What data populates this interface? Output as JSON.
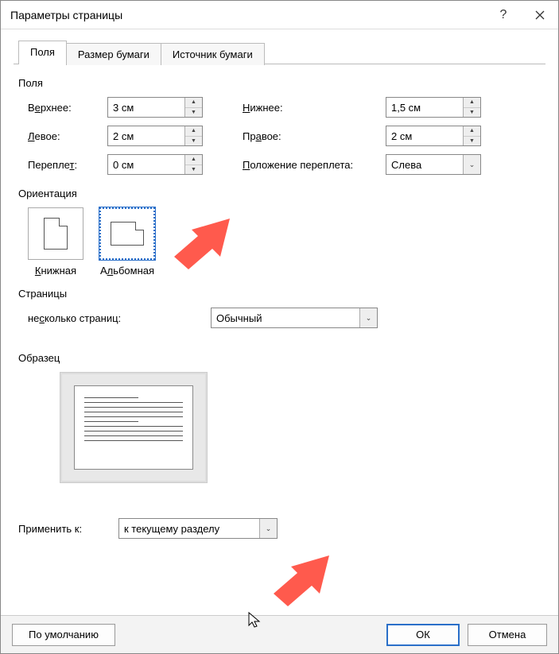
{
  "title": "Параметры страницы",
  "tabs": [
    "Поля",
    "Размер бумаги",
    "Источник бумаги"
  ],
  "margins": {
    "group_label": "Поля",
    "top_label_pre": "В",
    "top_label_u": "е",
    "top_label_post": "рхнее:",
    "bottom_label_pre": "",
    "bottom_label_u": "Н",
    "bottom_label_post": "ижнее:",
    "left_label_pre": "",
    "left_label_u": "Л",
    "left_label_post": "евое:",
    "right_label_pre": "Пр",
    "right_label_u": "а",
    "right_label_post": "вое:",
    "gutter_label_pre": "Перепле",
    "gutter_label_u": "т",
    "gutter_label_post": ":",
    "gutterpos_label_pre": "",
    "gutterpos_label_u": "П",
    "gutterpos_label_post": "оложение переплета:",
    "top": "3 см",
    "bottom": "1,5 см",
    "left": "2 см",
    "right": "2 см",
    "gutter": "0 см",
    "gutter_pos": "Слева"
  },
  "orientation": {
    "group_label": "Ориентация",
    "portrait_pre": "",
    "portrait_u": "К",
    "portrait_post": "нижная",
    "landscape_pre": "А",
    "landscape_u": "л",
    "landscape_post": "ьбомная"
  },
  "pages": {
    "group_label": "Страницы",
    "multi_pre": "не",
    "multi_u": "с",
    "multi_post": "колько страниц:",
    "multi_value": "Обычный"
  },
  "preview": {
    "group_label": "Образец"
  },
  "apply": {
    "label": "Применить к:",
    "value": "к текущему разделу"
  },
  "footer": {
    "default": "По умолчанию",
    "ok": "ОК",
    "cancel": "Отмена"
  }
}
